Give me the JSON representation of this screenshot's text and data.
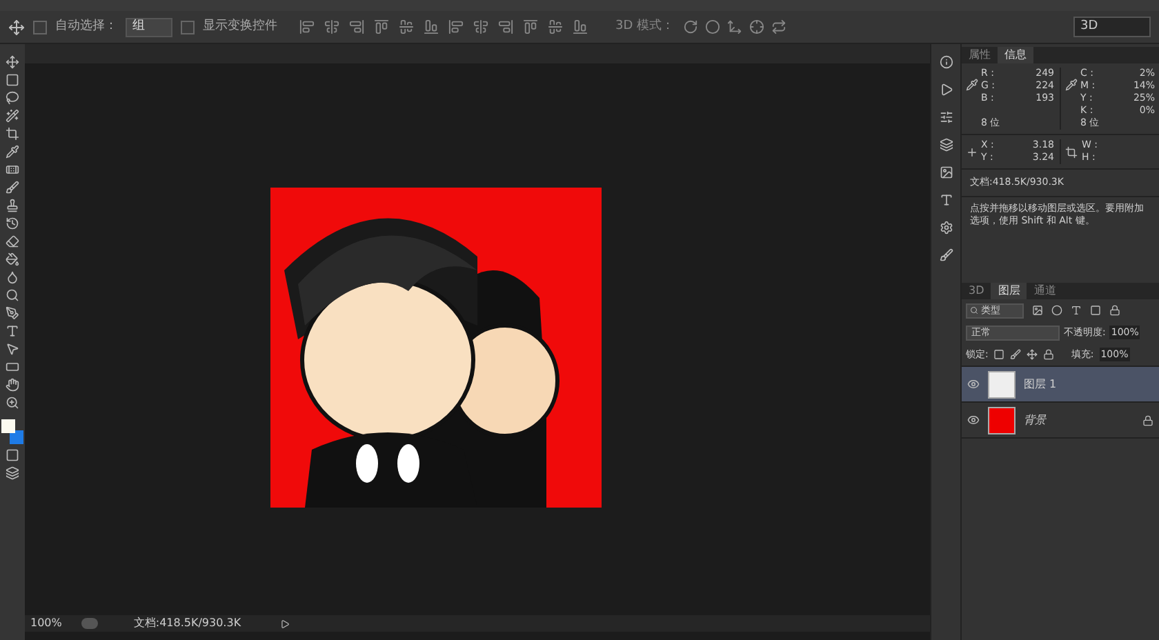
{
  "options": {
    "auto_select": {
      "label": "自动选择：",
      "checked": false
    },
    "auto_select_value": "组",
    "transform": {
      "label": "显示变换控件",
      "checked": false
    },
    "mode_3d": "3D 模式：",
    "workspace": "3D"
  },
  "info_panel": {
    "tabs": [
      {
        "label": "属性",
        "selected": false
      },
      {
        "label": "信息",
        "selected": true
      }
    ],
    "rgb": [
      {
        "label": "R :",
        "value": "249"
      },
      {
        "label": "G :",
        "value": "224"
      },
      {
        "label": "B :",
        "value": "193"
      }
    ],
    "cmyk": [
      {
        "label": "C :",
        "value": "2%"
      },
      {
        "label": "M :",
        "value": "14%"
      },
      {
        "label": "Y :",
        "value": "25%"
      },
      {
        "label": "K :",
        "value": "0%"
      }
    ],
    "bits_left": "8 位",
    "bits_right": "8 位",
    "xy": [
      {
        "label": "X :",
        "value": "3.18"
      },
      {
        "label": "Y :",
        "value": "3.24"
      }
    ],
    "wh": [
      {
        "label": "W :"
      },
      {
        "label": "H :"
      }
    ],
    "doc": "文档:418.5K/930.3K",
    "hint": "点按并拖移以移动图层或选区。要用附加选项，使用 Shift 和 Alt 键。"
  },
  "layers_panel": {
    "tabs": [
      {
        "label": "3D",
        "selected": false
      },
      {
        "label": "图层",
        "selected": true
      },
      {
        "label": "通道",
        "selected": false
      }
    ],
    "filter": "类型",
    "blend": "正常",
    "opacity_label": "不透明度:",
    "opacity": "100%",
    "lock_label": "锁定:",
    "fill_label": "填充:",
    "fill": "100%",
    "layers": [
      {
        "name": "图层 1",
        "selected": true,
        "locked": false,
        "italic": false
      },
      {
        "name": "背景",
        "selected": false,
        "locked": true,
        "italic": true
      }
    ]
  },
  "status_bar": {
    "zoom": "100%",
    "doc": "文档:418.5K/930.3K"
  }
}
